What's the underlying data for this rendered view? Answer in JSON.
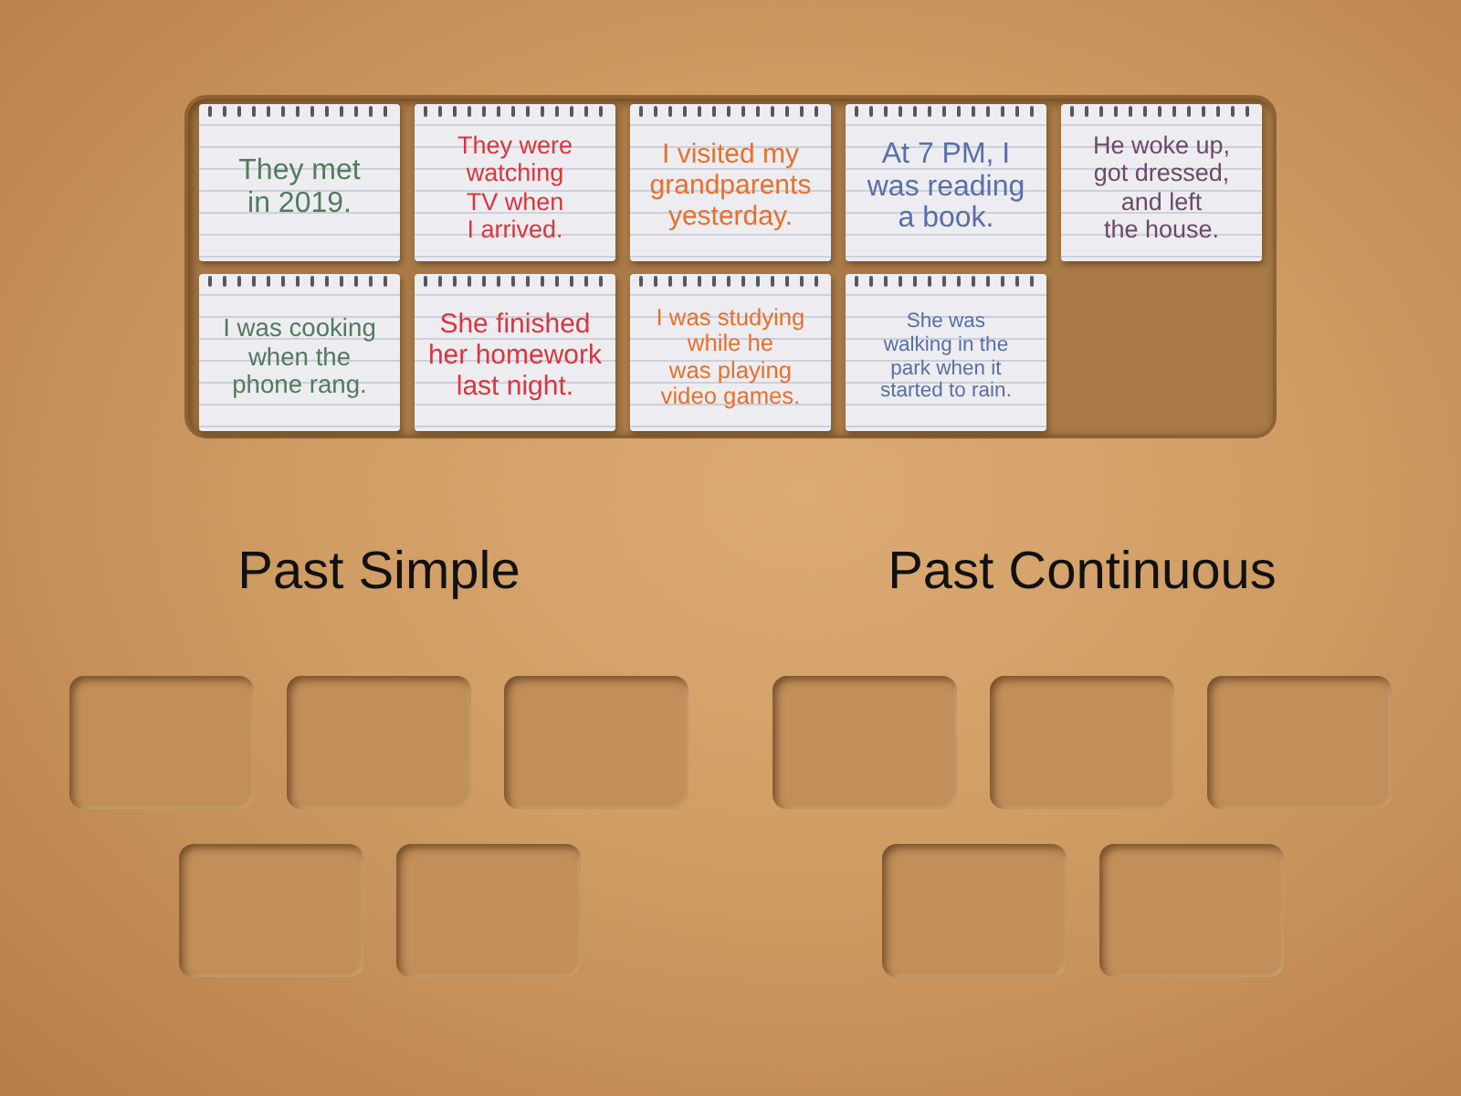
{
  "cards": [
    {
      "text": "They met\nin 2019.",
      "color": "#527a5e"
    },
    {
      "text": "They were\nwatching\nTV when\nI arrived.",
      "color": "#d8363f"
    },
    {
      "text": "I visited my\ngrandparents\nyesterday.",
      "color": "#e6702c"
    },
    {
      "text": "At 7 PM, I\nwas reading\na book.",
      "color": "#5a6ea8"
    },
    {
      "text": "He woke up,\ngot dressed,\nand left\nthe house.",
      "color": "#6b4a68"
    },
    {
      "text": "I was cooking\nwhen the\nphone rang.",
      "color": "#527a5e"
    },
    {
      "text": "She finished\nher homework\nlast night.",
      "color": "#d8363f"
    },
    {
      "text": "I was studying\nwhile he\nwas playing\nvideo games.",
      "color": "#e6702c"
    },
    {
      "text": "She was\nwalking in the\npark when it\nstarted to rain.",
      "color": "#5a6ea8"
    }
  ],
  "groups": [
    {
      "title": "Past Simple"
    },
    {
      "title": "Past Continuous"
    }
  ]
}
